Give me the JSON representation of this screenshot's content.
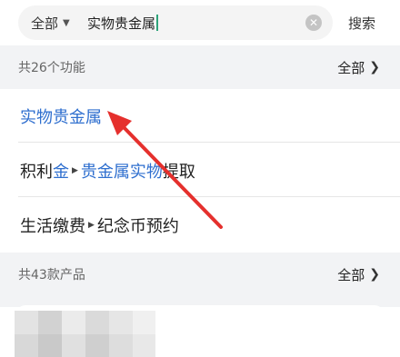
{
  "search": {
    "scope_label": "全部",
    "query": "实物贵金属",
    "button_label": "搜索"
  },
  "functions_section": {
    "count_label": "共26个功能",
    "all_label": "全部"
  },
  "function_results": [
    {
      "segments": [
        {
          "text": "实物贵金属",
          "highlight": true
        }
      ]
    },
    {
      "segments": [
        {
          "text": "积利",
          "highlight": false
        },
        {
          "text": "金",
          "highlight": true
        },
        {
          "sep": true
        },
        {
          "text": "贵金属实物",
          "highlight": true
        },
        {
          "text": "提取",
          "highlight": false
        }
      ]
    },
    {
      "segments": [
        {
          "text": "生活缴费",
          "highlight": false
        },
        {
          "sep": true
        },
        {
          "text": "纪念币预约",
          "highlight": false
        }
      ]
    }
  ],
  "products_section": {
    "count_label": "共43款产品",
    "all_label": "全部"
  },
  "colors": {
    "highlight": "#2f6fcf",
    "annotation_arrow": "#e5302d",
    "section_bg": "#f2f3f5"
  }
}
